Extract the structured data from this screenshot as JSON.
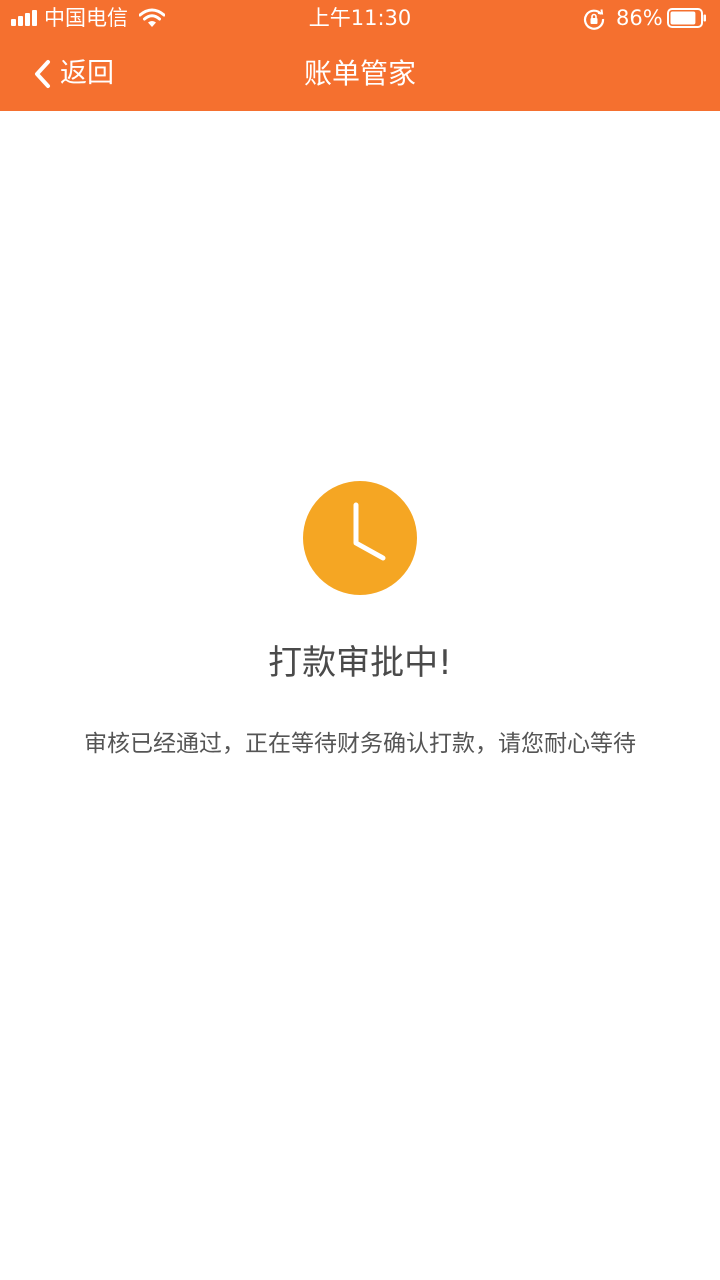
{
  "status_bar": {
    "carrier": "中国电信",
    "time": "上午11:30",
    "battery_percent": "86%",
    "battery_level": 0.86,
    "icons": [
      "signal-icon",
      "wifi-icon",
      "rotation-lock-icon",
      "battery-icon"
    ]
  },
  "nav": {
    "back_label": "返回",
    "back_icon": "chevron-left-icon",
    "title": "账单管家"
  },
  "content": {
    "icon": "clock-icon",
    "title": "打款审批中!",
    "description": "审核已经通过，正在等待财务确认打款，请您耐心等待"
  },
  "colors": {
    "header": "#f5702f",
    "clock": "#f5a623",
    "title_text": "#4a4a4a",
    "body_text": "#555555",
    "background": "#ffffff"
  }
}
